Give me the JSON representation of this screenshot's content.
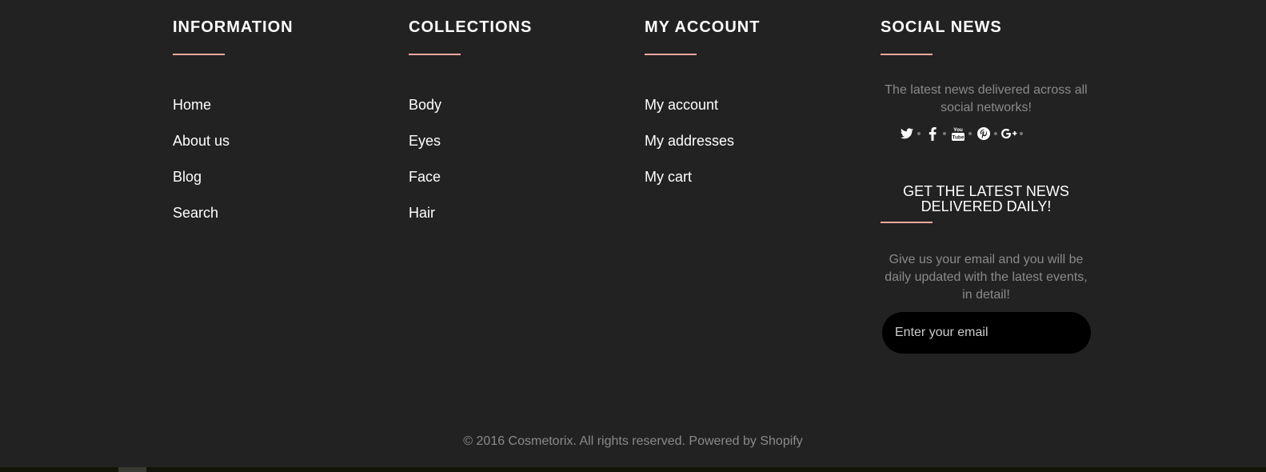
{
  "footer": {
    "information": {
      "heading": "INFORMATION",
      "links": [
        "Home",
        "About us",
        "Blog",
        "Search"
      ]
    },
    "collections": {
      "heading": "COLLECTIONS",
      "links": [
        "Body",
        "Eyes",
        "Face",
        "Hair"
      ]
    },
    "account": {
      "heading": "MY ACCOUNT",
      "links": [
        "My account",
        "My addresses",
        "My cart"
      ]
    },
    "social": {
      "heading": "SOCIAL NEWS",
      "text": "The latest news delivered across all social networks!",
      "icons": [
        "twitter-icon",
        "facebook-icon",
        "youtube-icon",
        "pinterest-icon",
        "google-plus-icon"
      ]
    },
    "newsletter": {
      "heading": "GET THE LATEST NEWS DELIVERED DAILY!",
      "text": "Give us your email and you will be daily updated with the latest events, in detail!",
      "email_placeholder": "Enter your email"
    },
    "copyright": "© 2016 Cosmetorix. All rights reserved. Powered by Shopify"
  },
  "colors": {
    "background": "#222222",
    "accent": "#f4a79d",
    "muted_text": "#8a8a8a",
    "input_bg": "#000000"
  }
}
